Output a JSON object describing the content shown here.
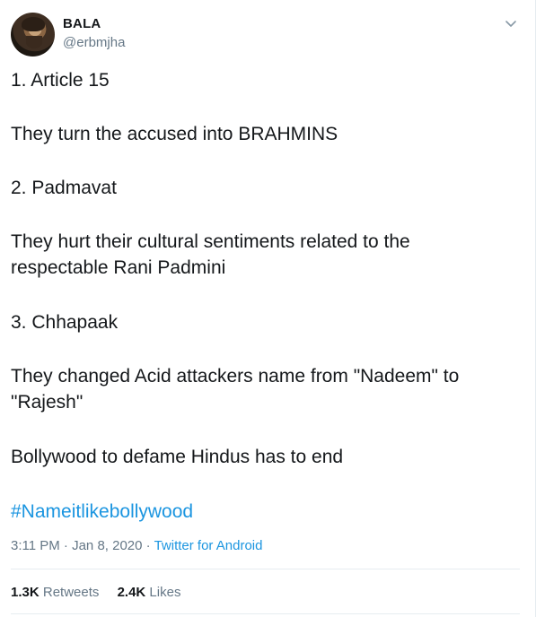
{
  "tweet": {
    "display_name": "BALA",
    "handle": "@erbmjha",
    "lines": [
      "1. Article 15",
      "They turn the accused into BRAHMINS",
      "2. Padmavat",
      "They hurt their cultural sentiments related to the",
      "respectable Rani Padmini",
      "3. Chhapaak",
      "They changed Acid attackers name from \"Nadeem\" to",
      "\"Rajesh\"",
      "Bollywood to defame Hindus has to end"
    ],
    "hashtag": "#Nameitlikebollywood",
    "time": "3:11 PM",
    "date": "Jan 8, 2020",
    "separator": "·",
    "source": "Twitter for Android",
    "retweets_count": "1.3K",
    "retweets_label": "Retweets",
    "likes_count": "2.4K",
    "likes_label": "Likes",
    "link_color": "#1b95e0",
    "icons": {
      "avatar": "profile-avatar",
      "menu": "chevron-down-icon"
    }
  }
}
